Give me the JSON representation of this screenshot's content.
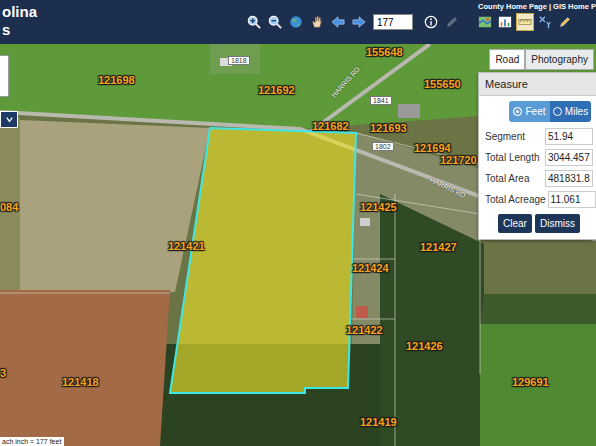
{
  "header": {
    "title": "olina",
    "subtitle": "s",
    "links": "County Home Page | GIS Home P",
    "scale_input": "177"
  },
  "tools_left": [
    {
      "kind": "zoom-in",
      "selected": false,
      "disabled": false
    },
    {
      "kind": "zoom-out",
      "selected": false,
      "disabled": false
    },
    {
      "kind": "globe",
      "selected": false,
      "disabled": false
    },
    {
      "kind": "pan",
      "selected": false,
      "disabled": false
    },
    {
      "kind": "back",
      "selected": false,
      "disabled": false
    },
    {
      "kind": "forward",
      "selected": false,
      "disabled": false
    }
  ],
  "tools_mid": [
    {
      "kind": "info",
      "selected": false,
      "disabled": false
    },
    {
      "kind": "edit",
      "selected": false,
      "disabled": true
    }
  ],
  "tools_right": [
    {
      "kind": "map",
      "selected": false,
      "disabled": false
    },
    {
      "kind": "chart",
      "selected": false,
      "disabled": false
    },
    {
      "kind": "ruler",
      "selected": true,
      "disabled": false
    },
    {
      "kind": "xy",
      "selected": false,
      "disabled": false
    },
    {
      "kind": "draw",
      "selected": false,
      "disabled": false
    }
  ],
  "map_types": [
    {
      "label": "Road",
      "selected": false
    },
    {
      "label": "Photography",
      "selected": true
    }
  ],
  "measure": {
    "title": "Measure",
    "units": [
      {
        "label": "Feet",
        "selected": true
      },
      {
        "label": "Miles",
        "selected": false
      }
    ],
    "rows": [
      {
        "label": "Segment",
        "value": "51.94"
      },
      {
        "label": "Total Length",
        "value": "3044.457"
      },
      {
        "label": "Total Area",
        "value": "481831.8"
      },
      {
        "label": "Total Acreage",
        "value": "11.061"
      }
    ],
    "buttons": [
      "Clear",
      "Dismiss"
    ]
  },
  "labels": [
    {
      "text": "155648",
      "kind": "parcel"
    },
    {
      "text": "1818",
      "kind": "address"
    },
    {
      "text": "121698",
      "kind": "parcel"
    },
    {
      "text": "121692",
      "kind": "parcel"
    },
    {
      "text": "155650",
      "kind": "parcel"
    },
    {
      "text": "HARRIS RD",
      "kind": "road"
    },
    {
      "text": "1841",
      "kind": "address"
    },
    {
      "text": "121682",
      "kind": "parcel"
    },
    {
      "text": "121693",
      "kind": "parcel"
    },
    {
      "text": "1802",
      "kind": "address"
    },
    {
      "text": "121694",
      "kind": "parcel"
    },
    {
      "text": "121720",
      "kind": "parcel"
    },
    {
      "text": "HARRIS RD",
      "kind": "road"
    },
    {
      "text": "121425",
      "kind": "parcel"
    },
    {
      "text": "084",
      "kind": "parcel"
    },
    {
      "text": "121421",
      "kind": "parcel"
    },
    {
      "text": "121427",
      "kind": "parcel"
    },
    {
      "text": "121424",
      "kind": "parcel"
    },
    {
      "text": "121422",
      "kind": "parcel"
    },
    {
      "text": "121426",
      "kind": "parcel"
    },
    {
      "text": "3",
      "kind": "parcel"
    },
    {
      "text": "121418",
      "kind": "parcel"
    },
    {
      "text": "129691",
      "kind": "parcel"
    },
    {
      "text": "121419",
      "kind": "parcel"
    }
  ],
  "scale": "ach inch = 177 feet"
}
